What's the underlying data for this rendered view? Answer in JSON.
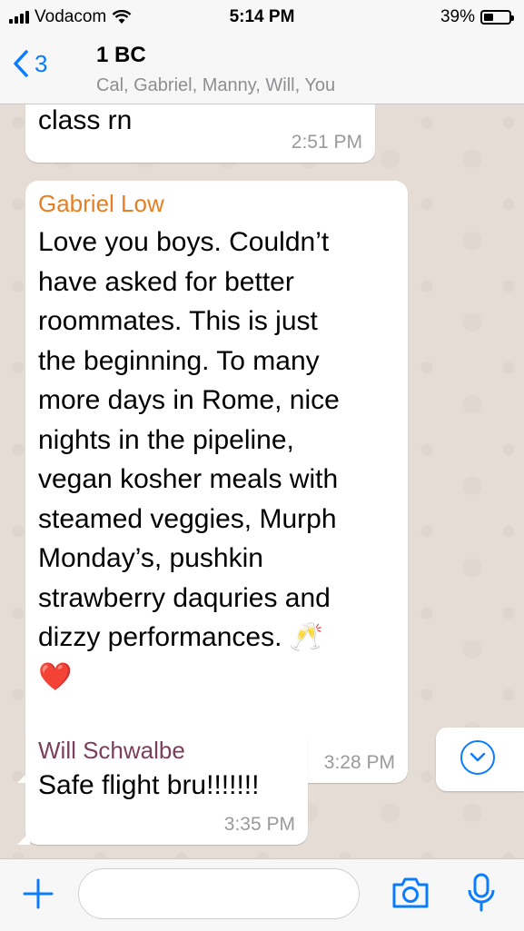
{
  "status_bar": {
    "carrier": "Vodacom",
    "time": "5:14 PM",
    "battery_percent": "39%",
    "battery_level": 0.39
  },
  "header": {
    "back_count": "3",
    "chat_name": "1 BC",
    "participants": "Cal, Gabriel, Manny, Will, You"
  },
  "messages": [
    {
      "sender": "",
      "text": "class rn",
      "time": "2:51 PM"
    },
    {
      "sender": "Gabriel Low",
      "sender_color": "#e67e22",
      "lines": [
        "Love you boys. Couldn’t",
        "have asked for better",
        "roommates. This is just",
        "the beginning. To many",
        "more days in Rome, nice",
        "nights in the pipeline,",
        "vegan kosher meals with",
        "steamed veggies, Murph",
        "Monday’s, pushkin",
        "strawberry daquries and",
        "dizzy performances. 🥂",
        "❤️"
      ],
      "time": "3:28 PM"
    },
    {
      "sender": "Will Schwalbe",
      "sender_color": "#7b3f5a",
      "text": "Safe flight bru!!!!!!!",
      "time": "3:35 PM"
    }
  ],
  "input_bar": {
    "placeholder": ""
  },
  "colors": {
    "accent": "#0a7cff",
    "chat_background": "#e5ddd5"
  },
  "icons": [
    "back-chevron-icon",
    "scroll-down-icon",
    "plus-icon",
    "camera-icon",
    "microphone-icon",
    "wifi-icon",
    "battery-icon"
  ]
}
